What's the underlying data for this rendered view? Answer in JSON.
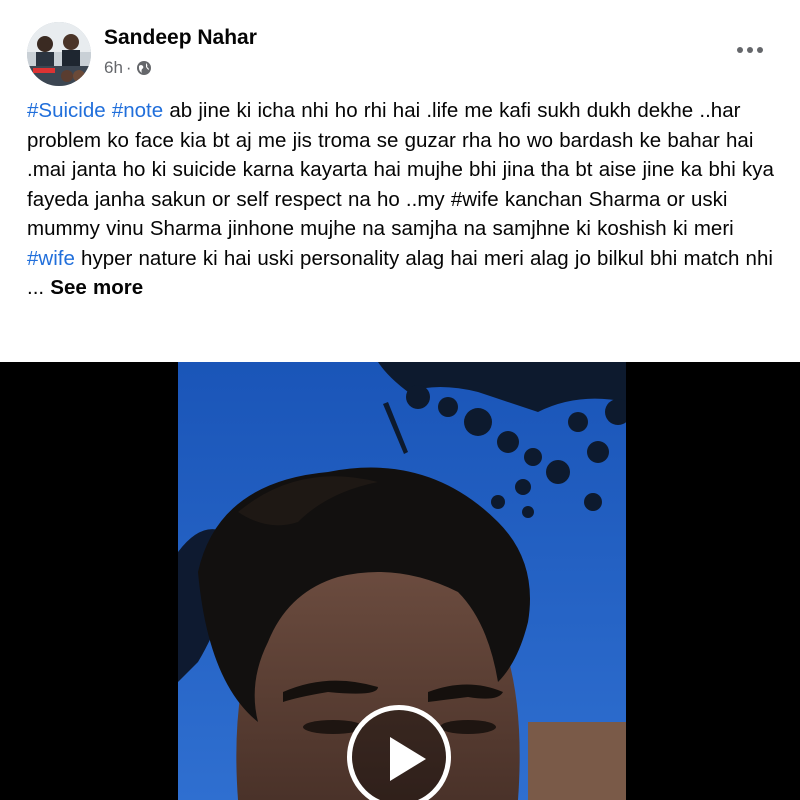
{
  "post": {
    "author": "Sandeep Nahar",
    "time": "6h",
    "separator": "·",
    "privacy_icon": "globe-icon",
    "more_icon": "more-horizontal-icon",
    "text": {
      "hashtag_suicide": "#Suicide",
      "hashtag_note": "#note",
      "part1": " ab jine ki icha nhi ho rhi hai .life me kafi sukh dukh dekhe ..har problem ko face kia bt aj me jis troma se guzar rha ho wo bardash ke bahar hai .mai janta ho ki suicide karna kayarta hai mujhe bhi jina tha bt aise jine ka bhi kya fayeda janha sakun or self respect na ho ..my #wife kanchan Sharma or uski mummy vinu Sharma jinhone mujhe na samjha na samjhne ki koshish ki meri ",
      "hashtag_wife": "#wife",
      "part2": " hyper nature ki hai uski personality alag hai meri alag jo bilkul bhi match nhi ... ",
      "see_more": "See more"
    },
    "video": {
      "play_icon": "play-icon"
    }
  },
  "colors": {
    "hashtag": "#216fdb",
    "text": "#050505",
    "meta": "#65676b",
    "sky": "#1b5ac0"
  }
}
